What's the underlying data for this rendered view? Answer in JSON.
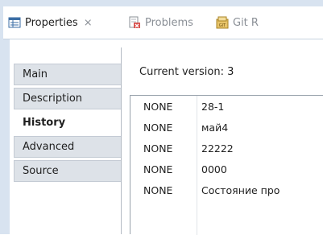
{
  "tabs": [
    {
      "label": "Properties",
      "icon": "properties-icon",
      "active": true
    },
    {
      "label": "Problems",
      "icon": "problems-icon",
      "active": false
    },
    {
      "label": "Git R",
      "icon": "git-repositories-icon",
      "active": false
    }
  ],
  "close_glyph": "⨯",
  "sections": [
    {
      "label": "Main"
    },
    {
      "label": "Description"
    },
    {
      "label": "History"
    },
    {
      "label": "Advanced"
    },
    {
      "label": "Source"
    }
  ],
  "active_section": "History",
  "current_version": "Current version: 3",
  "history": [
    {
      "user": "NONE",
      "comment": "28-1"
    },
    {
      "user": "NONE",
      "comment": "май4"
    },
    {
      "user": "NONE",
      "comment": "22222"
    },
    {
      "user": "NONE",
      "comment": "0000"
    },
    {
      "user": "NONE",
      "comment": "Состояние про"
    }
  ]
}
